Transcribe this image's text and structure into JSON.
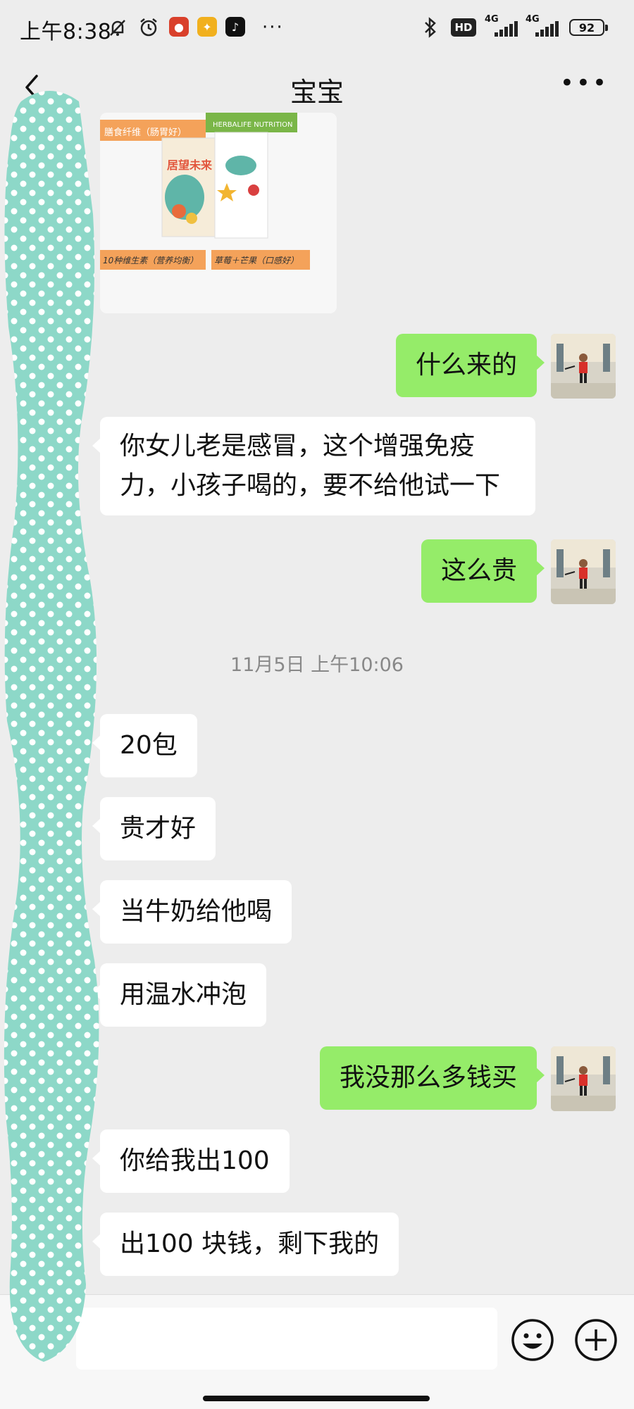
{
  "status_bar": {
    "time": "上午8:38",
    "more": "···",
    "hd": "HD",
    "network_1": "4G",
    "network_2": "4G",
    "battery": "92"
  },
  "nav": {
    "title": "宝宝"
  },
  "product_image": {
    "brand_left": "HERBALIFE NUTRITION",
    "brand_right": "HERBALIFE NUTRITION",
    "top_left_caption": "膳食纤维（肠胃好）",
    "box_text": "居望未来",
    "caption_left": "10种维生素（营养均衡）",
    "caption_right": "草莓＋芒果（口感好）"
  },
  "messages": [
    {
      "side": "out",
      "text": "什么来的"
    },
    {
      "side": "in",
      "line1": "你女儿老是感冒，这个增强免疫",
      "line2": "力，小孩子喝的，要不给他试一下"
    },
    {
      "side": "out",
      "text": "这么贵"
    },
    {
      "side": "in",
      "text": "20包"
    },
    {
      "side": "in",
      "text": "贵才好"
    },
    {
      "side": "in",
      "text": "当牛奶给他喝"
    },
    {
      "side": "in",
      "text": "用温水冲泡"
    },
    {
      "side": "out",
      "text": "我没那么多钱买"
    },
    {
      "side": "in",
      "text": "你给我出100"
    },
    {
      "side": "in",
      "text": "出100 块钱，剩下我的"
    }
  ],
  "timestamp": "11月5日 上午10:06",
  "colors": {
    "outgoing_bubble": "#95ec69",
    "incoming_bubble": "#ffffff",
    "background": "#ededed",
    "mask_teal": "#8dd8c8"
  }
}
